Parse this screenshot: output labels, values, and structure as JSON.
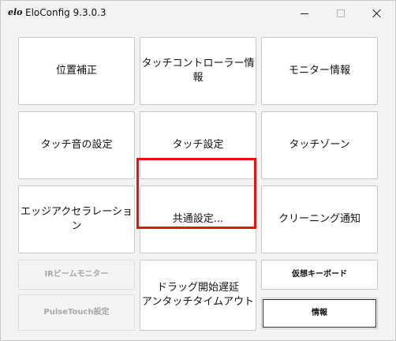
{
  "window": {
    "logo": "elo",
    "title": "EloConfig 9.3.0.3"
  },
  "tiles": {
    "calibration": "位置補正",
    "touch_controller_info": "タッチコントローラー情報",
    "monitor_info": "モニター情報",
    "touch_sound": "タッチ音の設定",
    "touch_settings": "タッチ設定",
    "touch_zone": "タッチゾーン",
    "edge_acceleration": "エッジアクセラレーション",
    "common_settings": "共通設定...",
    "cleaning_notice": "クリーニング通知",
    "ir_beam_monitor": "IRビームモニター",
    "pulsetouch_line1": "PulseTouch",
    "pulsetouch_line2": "設定",
    "drag_delay_line1": "ドラッグ開始遅延",
    "drag_delay_line2": "アンタッチタイムアウト",
    "virtual_keyboard": "仮想キーボード",
    "info": "情報"
  },
  "colors": {
    "highlight": "#e31414",
    "window_bg": "#f3f3f3",
    "tile_bg": "#ffffff",
    "disabled_text": "#a8a8a8"
  }
}
